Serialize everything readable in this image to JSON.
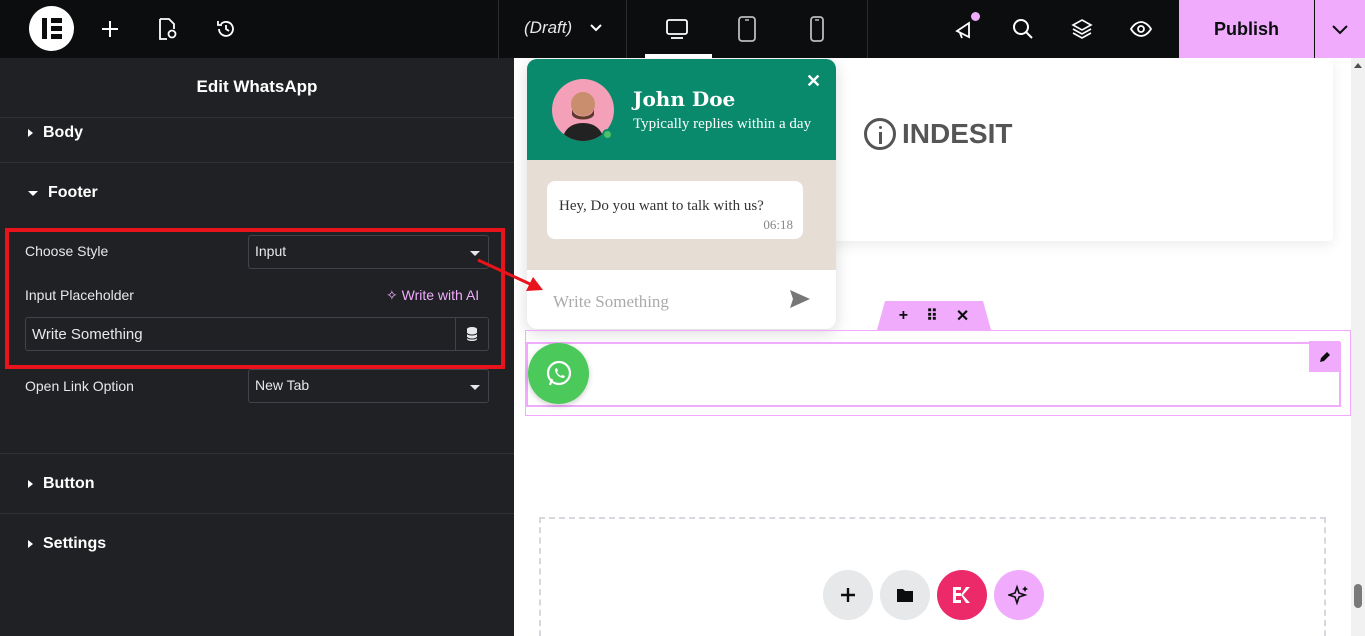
{
  "topbar": {
    "draft_label": "(Draft)",
    "publish_label": "Publish",
    "icons": [
      "elementor-logo-icon",
      "add-element-icon",
      "page-settings-icon",
      "history-icon",
      "chevron-down-icon",
      "desktop-icon",
      "tablet-icon",
      "mobile-icon",
      "notifications-icon",
      "search-icon",
      "structure-icon",
      "preview-icon",
      "chevron-down-icon"
    ]
  },
  "panel": {
    "title": "Edit WhatsApp",
    "sections": {
      "body": "Body",
      "footer": "Footer",
      "button": "Button",
      "settings": "Settings"
    },
    "controls": {
      "choose_style_label": "Choose Style",
      "choose_style_value": "Input",
      "input_placeholder_label": "Input Placeholder",
      "write_with_ai": "Write with AI",
      "input_placeholder_value": "Write Something",
      "open_link_label": "Open Link Option",
      "open_link_value": "New Tab"
    },
    "highlight_color": "#e8131b"
  },
  "canvas": {
    "brand_logo_text": "INDESIT",
    "whatsapp": {
      "name": "John Doe",
      "subtitle": "Typically replies within a day",
      "message": "Hey, Do you want to talk with us?",
      "time": "06:18",
      "input_placeholder": "Write Something",
      "header_color": "#0a8a6c"
    },
    "accent_color": "#f0abfc"
  }
}
